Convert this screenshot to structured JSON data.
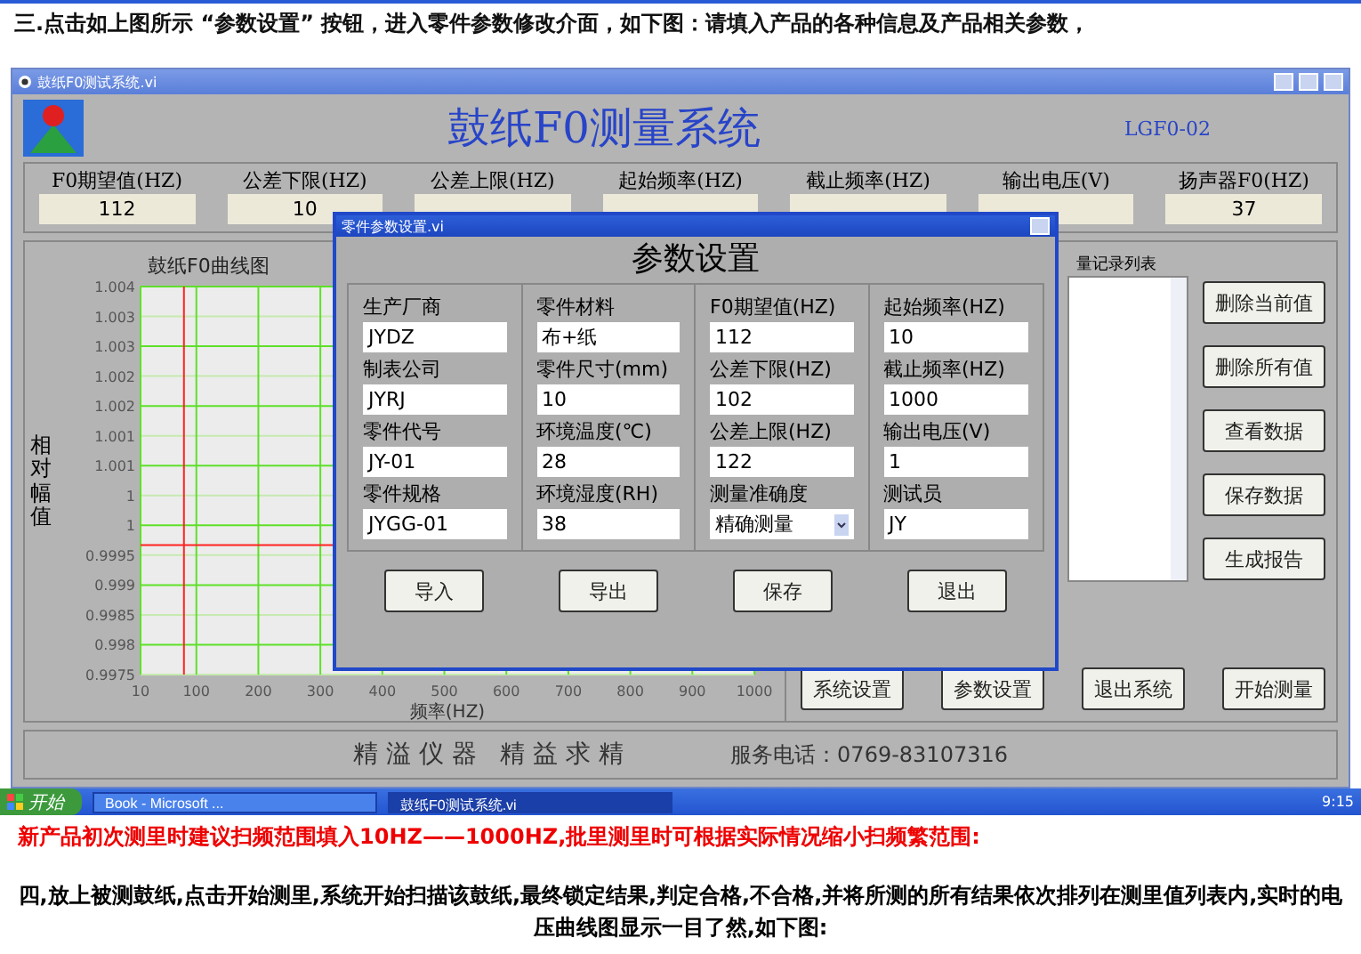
{
  "instruction": "三.点击如上图所示 “参数设置” 按钮，进入零件参数修改介面，如下图：请填入产品的各种信息及产品相关参数，",
  "window": {
    "title": "鼓纸F0测试系统.vi"
  },
  "header": {
    "title": "鼓纸F0测量系统",
    "model": "LGF0-02"
  },
  "params": [
    {
      "label": "F0期望值(HZ)",
      "value": "112"
    },
    {
      "label": "公差下限(HZ)",
      "value": "10"
    },
    {
      "label": "公差上限(HZ)"
    },
    {
      "label": "起始频率(HZ)"
    },
    {
      "label": "截止频率(HZ)"
    },
    {
      "label": "输出电压(V)"
    },
    {
      "label": "扬声器F0(HZ)",
      "value": "37"
    }
  ],
  "chart": {
    "chart_data": {
      "type": "line",
      "grid": true,
      "title": "鼓纸F0曲线图",
      "xlabel": "频率(HZ)",
      "ylabel": "相对幅值",
      "xlim": [
        10,
        1000
      ],
      "ylim": [
        0.9975,
        1.004
      ],
      "xticks": [
        10,
        100,
        200,
        300,
        400,
        500,
        600,
        700,
        800,
        900,
        1000
      ],
      "yticks": [
        {
          "value": 1.004,
          "label": "1.004"
        },
        {
          "value": 1.0035,
          "label": "1.003"
        },
        {
          "value": 1.003,
          "label": "1.003"
        },
        {
          "value": 1.0025,
          "label": "1.002"
        },
        {
          "value": 1.002,
          "label": "1.002"
        },
        {
          "value": 1.0015,
          "label": "1.001"
        },
        {
          "value": 1.001,
          "label": "1.001"
        },
        {
          "value": 1.0005,
          "label": "1"
        },
        {
          "value": 1,
          "label": "1"
        },
        {
          "value": 0.9995,
          "label": "0.9995"
        },
        {
          "value": 0.999,
          "label": "0.999"
        },
        {
          "value": 0.9985,
          "label": "0.9985"
        },
        {
          "value": 0.998,
          "label": "0.998"
        },
        {
          "value": 0.9975,
          "label": "0.9975"
        }
      ],
      "ref_lines": [
        {
          "axis": "x",
          "value": 80,
          "color": "#ff2222"
        },
        {
          "axis": "y",
          "value": 0.99967,
          "color": "#ff2222"
        }
      ]
    }
  },
  "list": {
    "title": "量记录列表"
  },
  "side_buttons": [
    "删除当前值",
    "删除所有值",
    "查看数据",
    "保存数据",
    "生成报告"
  ],
  "bottom_buttons": [
    "系统设置",
    "参数设置",
    "退出系统",
    "开始测量"
  ],
  "footer": {
    "slogan": "精 溢 仪 器   精 益 求 精",
    "phone": "服务电话：0769-83107316"
  },
  "dialog": {
    "title": "零件参数设置.vi",
    "heading": "参数设置",
    "columns": [
      [
        {
          "kind": "text",
          "label": "生产厂商",
          "value": "JYDZ"
        },
        {
          "kind": "text",
          "label": "制表公司",
          "value": "JYRJ"
        },
        {
          "kind": "text",
          "label": "零件代号",
          "value": "JY-01"
        },
        {
          "kind": "text",
          "label": "零件规格",
          "value": "JYGG-01"
        }
      ],
      [
        {
          "kind": "text",
          "label": "零件材料",
          "value": "布+纸"
        },
        {
          "kind": "text",
          "label": "零件尺寸(mm)",
          "value": "10"
        },
        {
          "kind": "text",
          "label": "环境温度(℃)",
          "value": "28"
        },
        {
          "kind": "text",
          "label": "环境湿度(RH)",
          "value": "38"
        }
      ],
      [
        {
          "kind": "text",
          "label": "F0期望值(HZ)",
          "value": "112"
        },
        {
          "kind": "text",
          "label": "公差下限(HZ)",
          "value": "102"
        },
        {
          "kind": "text",
          "label": "公差上限(HZ)",
          "value": "122"
        },
        {
          "kind": "select",
          "label": "测量准确度",
          "value": "精确测量"
        }
      ],
      [
        {
          "kind": "text",
          "label": "起始频率(HZ)",
          "value": "10"
        },
        {
          "kind": "text",
          "label": "截止频率(HZ)",
          "value": "1000"
        },
        {
          "kind": "text",
          "label": "输出电压(V)",
          "value": "1"
        },
        {
          "kind": "text",
          "label": "测试员",
          "value": "JY"
        }
      ]
    ],
    "buttons": [
      "导入",
      "导出",
      "保存",
      "退出"
    ]
  },
  "taskbar": {
    "start": "开始",
    "tasks": [
      {
        "label": "Book - Microsoft ...",
        "selected": false
      },
      {
        "label": "鼓纸F0测试系统.vi",
        "selected": true
      }
    ],
    "time": "9:15"
  },
  "note": "新产品初次测里时建议扫频范围填入10HZ——1000HZ,批里测里时可根据实际情况缩小扫频繁范围:",
  "paragraph": "四,放上被测鼓纸,点击开始测里,系统开始扫描该鼓纸,最终锁定结果,判定合格,不合格,并将所测的所有结果依次排列在测里值列表内,实时的电压曲线图显示一目了然,如下图:"
}
